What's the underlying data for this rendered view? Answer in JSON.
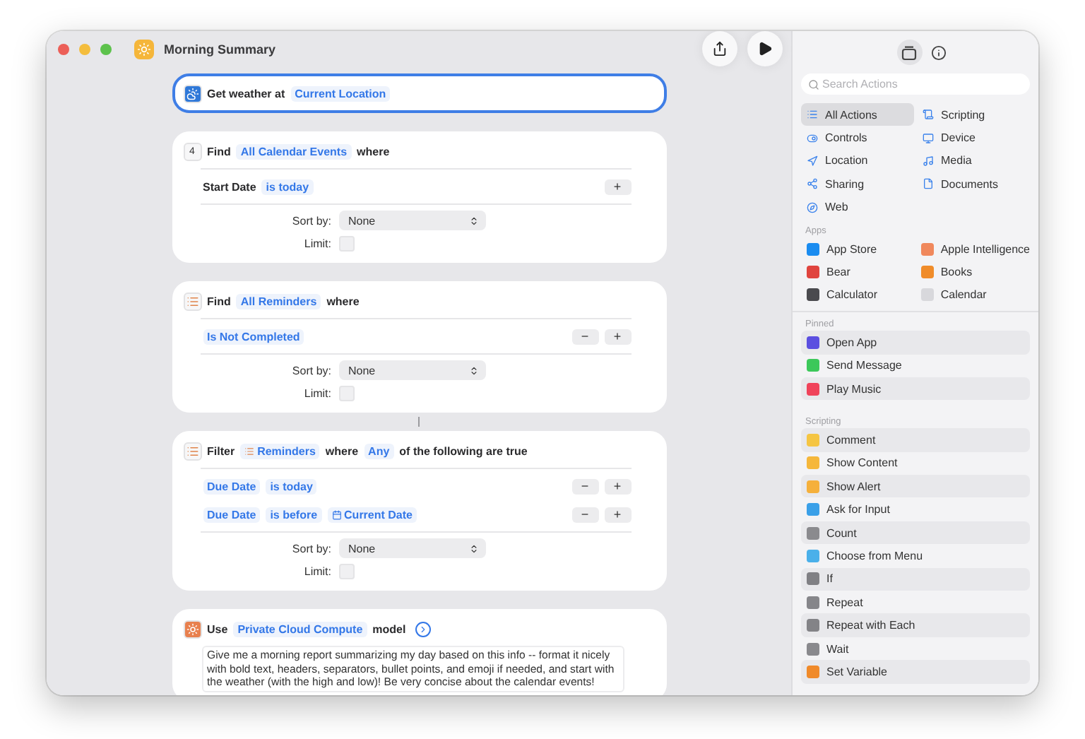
{
  "window": {
    "title": "Morning Summary"
  },
  "actions": [
    {
      "kind": "weather",
      "header": [
        {
          "kind": "label",
          "text": "Get weather at"
        },
        {
          "kind": "token",
          "text": "Current Location"
        }
      ],
      "selected": true
    },
    {
      "kind": "calendar",
      "icon_label": "4",
      "header": [
        {
          "kind": "label",
          "text": "Find"
        },
        {
          "kind": "token",
          "text": "All Calendar Events"
        },
        {
          "kind": "label",
          "text": "where"
        }
      ],
      "selected": false,
      "conditions": [
        {
          "parts": [
            {
              "kind": "label",
              "text": "Start Date"
            },
            {
              "kind": "token",
              "text": "is today"
            }
          ],
          "controls": [
            "+"
          ]
        }
      ],
      "sort": {
        "label": "Sort by:",
        "value": "None"
      },
      "limit": {
        "label": "Limit:",
        "checked": false
      }
    },
    {
      "kind": "reminders",
      "header": [
        {
          "kind": "label",
          "text": "Find"
        },
        {
          "kind": "token",
          "text": "All Reminders"
        },
        {
          "kind": "label",
          "text": "where"
        }
      ],
      "selected": false,
      "conditions": [
        {
          "parts": [
            {
              "kind": "token",
              "text": "Is Not Completed"
            }
          ],
          "controls": [
            "−",
            "+"
          ]
        }
      ],
      "sort": {
        "label": "Sort by:",
        "value": "None"
      },
      "limit": {
        "label": "Limit:",
        "checked": false
      }
    },
    {
      "kind": "reminders",
      "header": [
        {
          "kind": "label",
          "text": "Filter"
        },
        {
          "kind": "list-token",
          "text": "Reminders"
        },
        {
          "kind": "label",
          "text": "where"
        },
        {
          "kind": "token",
          "text": "Any"
        },
        {
          "kind": "label",
          "text": "of the following are true"
        }
      ],
      "selected": false,
      "conditions": [
        {
          "parts": [
            {
              "kind": "token",
              "text": "Due Date"
            },
            {
              "kind": "token",
              "text": "is today"
            }
          ],
          "controls": [
            "−",
            "+"
          ]
        },
        {
          "parts": [
            {
              "kind": "token",
              "text": "Due Date"
            },
            {
              "kind": "token",
              "text": "is before"
            },
            {
              "kind": "date-token",
              "text": "Current Date"
            }
          ],
          "controls": [
            "−",
            "+"
          ]
        }
      ],
      "sort": {
        "label": "Sort by:",
        "value": "None"
      },
      "limit": {
        "label": "Limit:",
        "checked": false
      }
    },
    {
      "kind": "model",
      "header": [
        {
          "kind": "label",
          "text": "Use"
        },
        {
          "kind": "token",
          "text": "Private Cloud Compute"
        },
        {
          "kind": "label",
          "text": "model"
        }
      ],
      "selected": false,
      "prompt": "Give me a morning report summarizing my day based on this info -- format it nicely with bold text, headers, separators, bullet points, and emoji if needed, and start with the weather (with the high and low)! Be very concise about the calendar events!"
    }
  ],
  "sidebar": {
    "toolbar": [
      {
        "kind": "library",
        "selected": true
      },
      {
        "kind": "info",
        "selected": false
      }
    ],
    "search": {
      "placeholder": "Search Actions"
    },
    "categories": [
      {
        "label": "All Actions",
        "selected": true
      },
      {
        "label": "Scripting",
        "selected": false
      },
      {
        "label": "Controls",
        "selected": false
      },
      {
        "label": "Device",
        "selected": false
      },
      {
        "label": "Location",
        "selected": false
      },
      {
        "label": "Media",
        "selected": false
      },
      {
        "label": "Sharing",
        "selected": false
      },
      {
        "label": "Documents",
        "selected": false
      },
      {
        "label": "Web",
        "selected": false
      }
    ],
    "apps": {
      "title": "Apps",
      "items": [
        {
          "label": "App Store",
          "color": "#1a8cf0"
        },
        {
          "label": "Apple Intelligence",
          "color": "#f0885c"
        },
        {
          "label": "Bear",
          "color": "#e0443e"
        },
        {
          "label": "Books",
          "color": "#f08c2a"
        },
        {
          "label": "Calculator",
          "color": "#4a4a4e"
        },
        {
          "label": "Calendar",
          "color": "#d8d8dc"
        }
      ]
    },
    "sections": [
      {
        "title": "Pinned",
        "items": [
          {
            "label": "Open App",
            "color": "#5b4fe0"
          },
          {
            "label": "Send Message",
            "color": "#3cc85a"
          },
          {
            "label": "Play Music",
            "color": "#f0435a"
          }
        ]
      },
      {
        "title": "Scripting",
        "items": [
          {
            "label": "Comment",
            "color": "#f5c542"
          },
          {
            "label": "Show Content",
            "color": "#f5b73b"
          },
          {
            "label": "Show Alert",
            "color": "#f5b03b"
          },
          {
            "label": "Ask for Input",
            "color": "#3aa0e8"
          },
          {
            "label": "Count",
            "color": "#8a8a8e"
          },
          {
            "label": "Choose from Menu",
            "color": "#4ab0ea"
          },
          {
            "label": "If",
            "color": "#808084"
          },
          {
            "label": "Repeat",
            "color": "#86868a"
          },
          {
            "label": "Repeat with Each",
            "color": "#838387"
          },
          {
            "label": "Wait",
            "color": "#89898d"
          },
          {
            "label": "Set Variable",
            "color": "#f08a2a"
          }
        ]
      }
    ]
  }
}
